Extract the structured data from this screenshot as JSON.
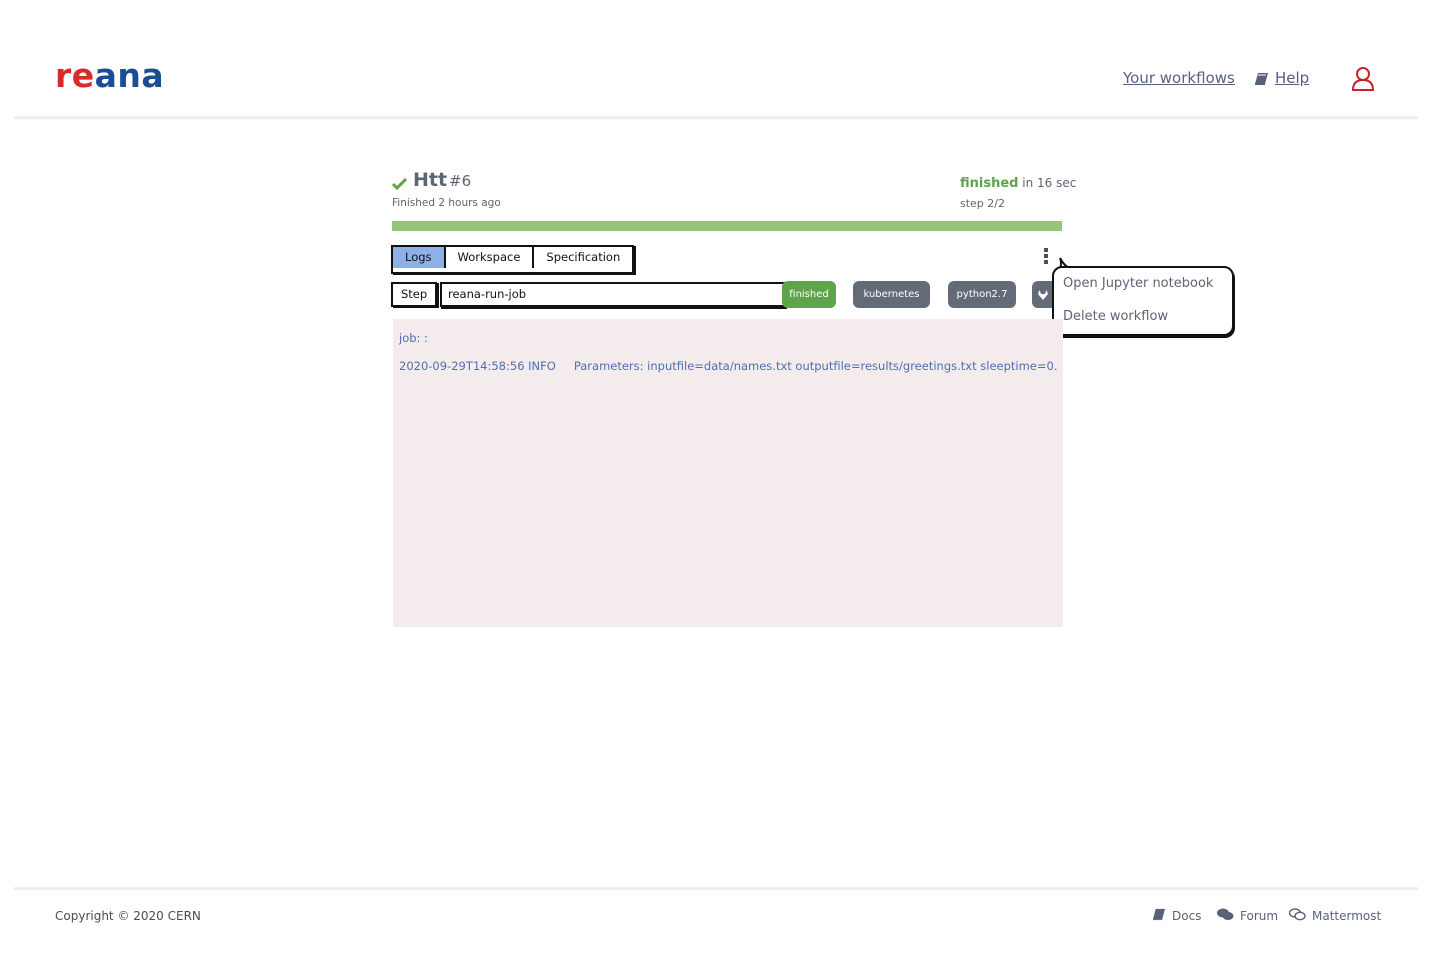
{
  "header": {
    "logo_part1": "re",
    "logo_part2": "ana",
    "nav_workflows": "Your workflows",
    "nav_help": "Help"
  },
  "workflow": {
    "name": "Htt",
    "run": "#6",
    "finished_ago": "Finished 2 hours ago",
    "status": "finished",
    "duration": "in 16 sec",
    "step_progress": "step 2/2",
    "progress_fraction": 1.0
  },
  "tabs": [
    "Logs",
    "Workspace",
    "Specification"
  ],
  "step": {
    "label": "Step",
    "selected": "reana-run-job"
  },
  "badges": {
    "status": "finished",
    "backend": "kubernetes",
    "image": "python2.7"
  },
  "menu": {
    "open_jupyter": "Open Jupyter notebook",
    "delete": "Delete workflow"
  },
  "log": {
    "job": "job: :",
    "timestamp": "2020-09-29T14:58:56 INFO",
    "message": "Parameters: inputfile=data/names.txt outputfile=results/greetings.txt sleeptime=0."
  },
  "footer": {
    "copyright": "Copyright © 2020 CERN",
    "docs": "Docs",
    "forum": "Forum",
    "mattermost": "Mattermost"
  },
  "colors": {
    "brand_red": "#d92a2a",
    "brand_blue": "#1a4e92",
    "success": "#5da44a",
    "badge_grey": "#636b78",
    "active_tab": "#8fb0e6",
    "log_bg": "#f4ecec"
  }
}
